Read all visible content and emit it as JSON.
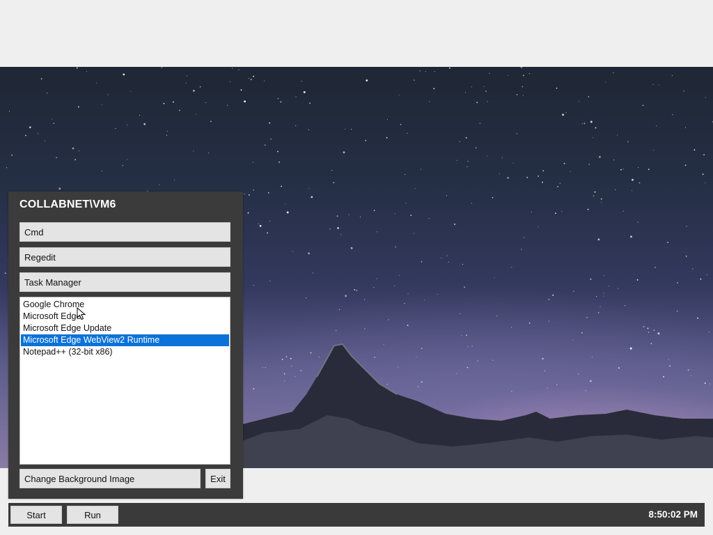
{
  "launcher": {
    "title": "COLLABNET\\VM6",
    "buttons": {
      "cmd": "Cmd",
      "regedit": "Regedit",
      "task_manager": "Task Manager",
      "change_background": "Change Background Image",
      "exit": "Exit"
    },
    "apps": [
      {
        "label": "Google Chrome",
        "selected": false
      },
      {
        "label": "Microsoft Edge",
        "selected": false
      },
      {
        "label": "Microsoft Edge Update",
        "selected": false
      },
      {
        "label": "Microsoft Edge WebView2 Runtime",
        "selected": true
      },
      {
        "label": "Notepad++ (32-bit x86)",
        "selected": false
      }
    ]
  },
  "taskbar": {
    "start": "Start",
    "run": "Run",
    "clock": "8:50:02 PM"
  },
  "colors": {
    "selection": "#0a72d8",
    "panel": "#3b3b3b",
    "button": "#e4e4e4"
  }
}
